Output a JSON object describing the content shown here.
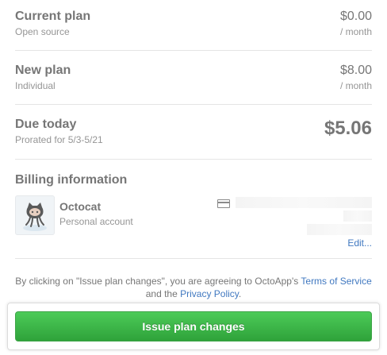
{
  "current_plan": {
    "title": "Current plan",
    "subtitle": "Open source",
    "price": "$0.00",
    "period": "/ month"
  },
  "new_plan": {
    "title": "New plan",
    "subtitle": "Individual",
    "price": "$8.00",
    "period": "/ month"
  },
  "due_today": {
    "title": "Due today",
    "subtitle": "Prorated for 5/3-5/21",
    "amount": "$5.06"
  },
  "billing": {
    "title": "Billing information",
    "account_name": "Octocat",
    "account_type": "Personal account",
    "edit_label": "Edit..."
  },
  "terms": {
    "prefix": "By clicking on \"Issue plan changes\", you are agreeing to OctoApp's ",
    "terms_link": "Terms of Service",
    "middle": " and the ",
    "privacy_link": "Privacy Policy",
    "suffix": "."
  },
  "actions": {
    "issue_label": "Issue plan changes"
  },
  "colors": {
    "accent_green": "#2fa23a",
    "link_blue": "#4078c0"
  }
}
